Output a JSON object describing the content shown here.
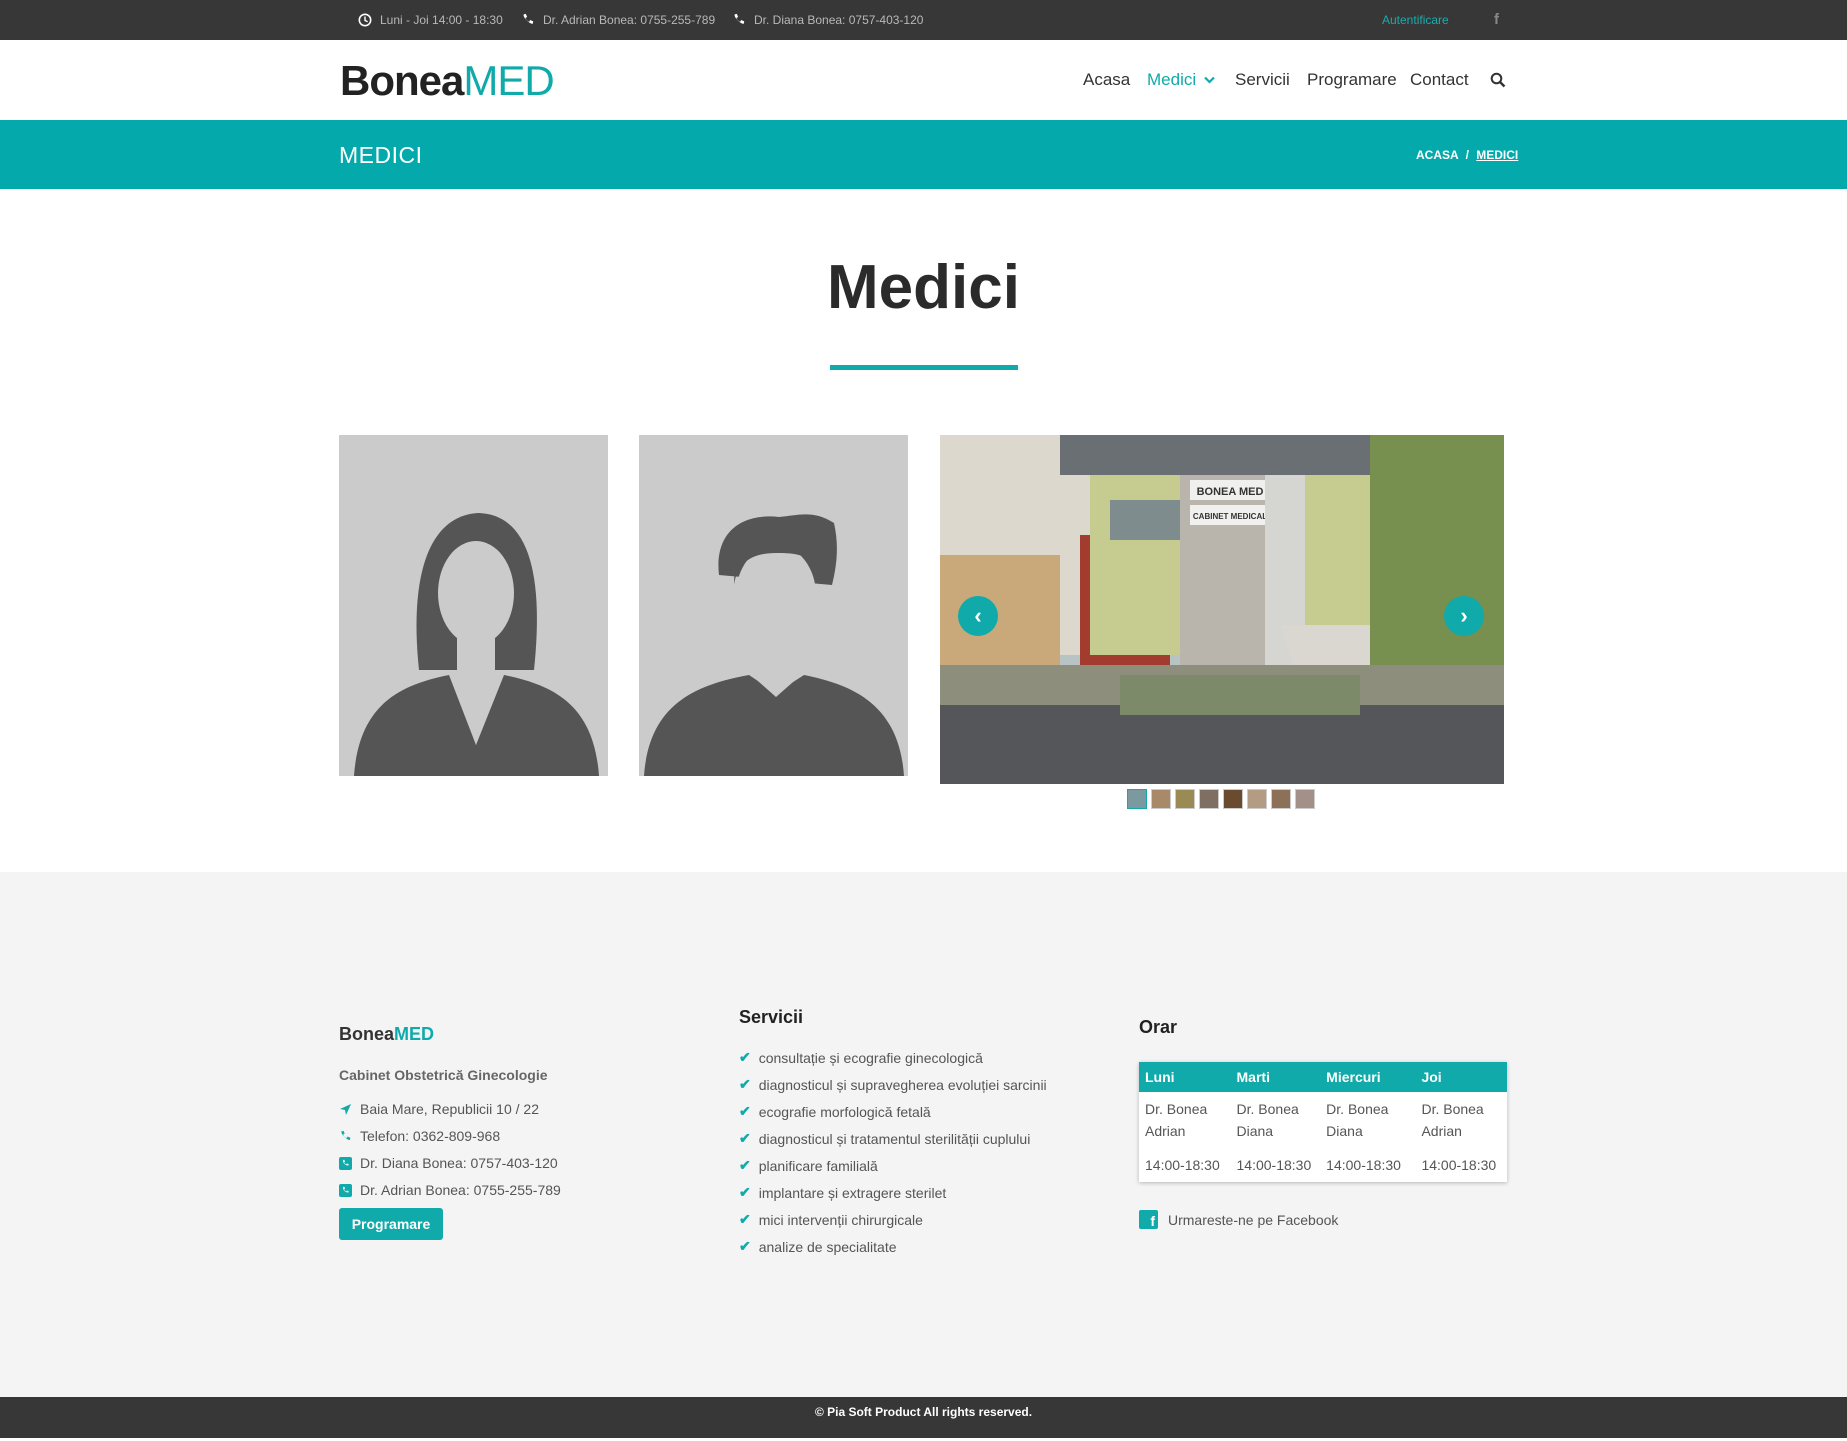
{
  "topbar": {
    "hours": "Luni - Joi 14:00 - 18:30",
    "phone_adrian": "Dr. Adrian Bonea: 0755-255-789",
    "phone_diana": "Dr. Diana Bonea: 0757-403-120",
    "login": "Autentificare",
    "facebook_glyph": "f"
  },
  "header": {
    "logo_bold": "Bonea",
    "logo_accent": "MED",
    "nav": {
      "acasa": "Acasa",
      "medici": "Medici",
      "servicii": "Servicii",
      "programare": "Programare",
      "contact": "Contact"
    }
  },
  "band": {
    "title": "MEDICI",
    "breadcrumb_home": "ACASA",
    "breadcrumb_sep": "/",
    "breadcrumb_current": "MEDICI"
  },
  "main": {
    "heading": "Medici",
    "carousel_prev": "‹",
    "carousel_next": "›",
    "thumbnail_count": 8,
    "photo_sign_1": "BONEA MED",
    "photo_sign_2": "CABINET MEDICAL"
  },
  "footer": {
    "logo_bold": "Bonea",
    "logo_accent": "MED",
    "subtitle": "Cabinet Obstetrică Ginecologie",
    "address": "Baia Mare, Republicii 10 / 22",
    "phone": "Telefon: 0362-809-968",
    "phone_diana": "Dr. Diana Bonea: 0757-403-120",
    "phone_adrian": "Dr. Adrian Bonea: 0755-255-789",
    "button": "Programare",
    "services_title": "Servicii",
    "services": [
      "consultație și ecografie ginecologică",
      "diagnosticul și supravegherea evoluției sarcinii",
      "ecografie morfologică fetală",
      "diagnosticul și tratamentul sterilității cuplului",
      "planificare familială",
      "implantare și extragere sterilet",
      "mici intervenții chirurgicale",
      "analize de specialitate"
    ],
    "schedule_title": "Orar",
    "schedule": {
      "headers": [
        "Luni",
        "Marti",
        "Miercuri",
        "Joi"
      ],
      "doctors": [
        "Dr. Bonea Adrian",
        "Dr. Bonea Diana",
        "Dr. Bonea Diana",
        "Dr. Bonea Adrian"
      ],
      "hours": [
        "14:00-18:30",
        "14:00-18:30",
        "14:00-18:30",
        "14:00-18:30"
      ]
    },
    "facebook_follow": "Urmareste-ne pe Facebook",
    "copyright": "© Pia Soft Product All rights reserved."
  },
  "colors": {
    "accent": "#10aaaa",
    "band": "#04a9ab",
    "dark_bar": "#373737",
    "footer_bg": "#f4f4f5"
  },
  "icons": [
    "clock-icon",
    "phone-icon",
    "facebook-icon",
    "chevron-down-icon",
    "search-icon",
    "location-arrow-icon",
    "phone-square-icon",
    "check-icon"
  ]
}
